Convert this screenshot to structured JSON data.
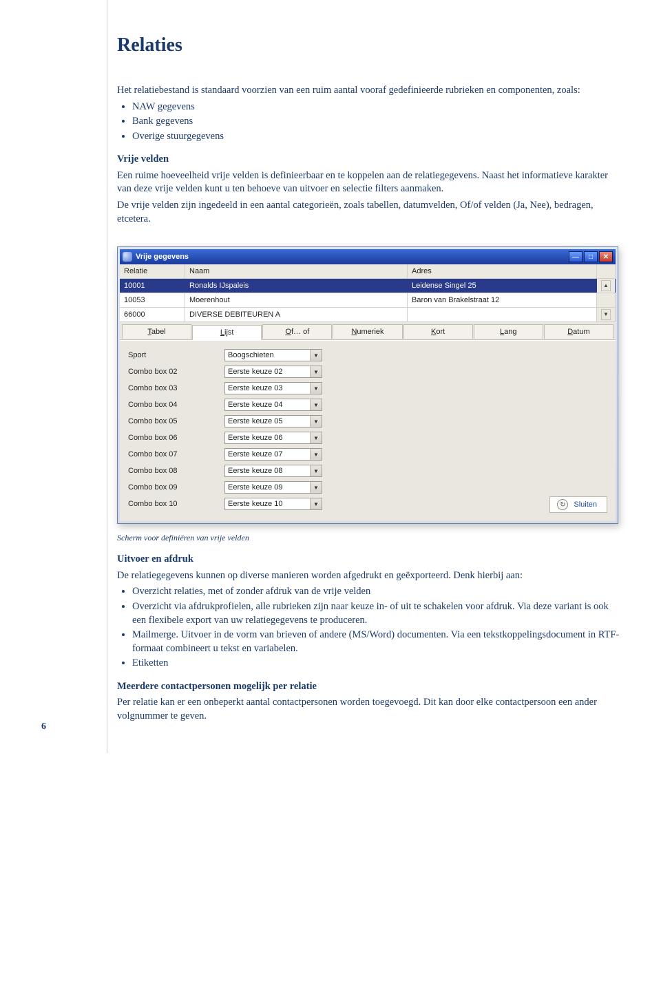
{
  "heading": "Relaties",
  "intro_p1": "Het relatiebestand is standaard voorzien van een ruim aantal vooraf gedefinieerde rubrieken en componenten, zoals:",
  "intro_bullets": [
    "NAW gegevens",
    "Bank gegevens",
    "Overige stuurgegevens"
  ],
  "vrije_head": "Vrije velden",
  "vrije_p1": "Een ruime hoeveelheid vrije velden is definieerbaar en te koppelen aan de relatiegegevens. Naast het informatieve karakter van deze vrije velden kunt u ten behoeve van uitvoer en selectie filters aanmaken.",
  "vrije_p2": "De vrije velden zijn ingedeeld in een aantal categorieën, zoals tabellen, datumvelden, Of/of velden (Ja, Nee), bedragen, etcetera.",
  "window": {
    "title": "Vrije gegevens",
    "headers": {
      "relatie": "Relatie",
      "naam": "Naam",
      "adres": "Adres"
    },
    "rows": [
      {
        "relatie": "10001",
        "naam": "Ronalds IJspaleis",
        "adres": "Leidense Singel 25",
        "selected": true
      },
      {
        "relatie": "10053",
        "naam": "Moerenhout",
        "adres": "Baron van Brakelstraat 12",
        "selected": false
      },
      {
        "relatie": "66000",
        "naam": "DIVERSE DEBITEUREN A",
        "adres": "",
        "selected": false
      }
    ],
    "tabs": [
      {
        "pre": "",
        "u": "T",
        "post": "abel"
      },
      {
        "pre": "",
        "u": "L",
        "post": "ijst",
        "active": true
      },
      {
        "pre": "",
        "u": "O",
        "post": "f… of"
      },
      {
        "pre": "",
        "u": "N",
        "post": "umeriek"
      },
      {
        "pre": "",
        "u": "K",
        "post": "ort"
      },
      {
        "pre": "",
        "u": "L",
        "post": "ang"
      },
      {
        "pre": "",
        "u": "D",
        "post": "atum"
      }
    ],
    "fields": [
      {
        "label": "Sport",
        "value": "Boogschieten"
      },
      {
        "label": "Combo box 02",
        "value": "Eerste keuze 02"
      },
      {
        "label": "Combo box 03",
        "value": "Eerste keuze 03"
      },
      {
        "label": "Combo box 04",
        "value": "Eerste keuze 04"
      },
      {
        "label": "Combo box 05",
        "value": "Eerste keuze 05"
      },
      {
        "label": "Combo box 06",
        "value": "Eerste keuze 06"
      },
      {
        "label": "Combo box 07",
        "value": "Eerste keuze 07"
      },
      {
        "label": "Combo box 08",
        "value": "Eerste keuze 08"
      },
      {
        "label": "Combo box 09",
        "value": "Eerste keuze 09"
      },
      {
        "label": "Combo box 10",
        "value": "Eerste keuze 10"
      }
    ],
    "close_label": "Sluiten"
  },
  "caption": "Scherm voor definiëren van vrije velden",
  "uitvoer_head": "Uitvoer en afdruk",
  "uitvoer_p": "De relatiegegevens kunnen op diverse manieren worden afgedrukt en geëxporteerd. Denk hierbij aan:",
  "uitvoer_bullets": [
    "Overzicht relaties, met of zonder afdruk van de vrije velden",
    "Overzicht via afdrukprofielen, alle rubrieken zijn naar keuze in- of uit te schakelen voor afdruk. Via deze variant is ook een flexibele export van uw relatiegegevens te produceren.",
    "Mailmerge. Uitvoer in de vorm van brieven of andere (MS/Word) documenten. Via een tekstkoppelingsdocument in RTF-formaat combineert u tekst en variabelen.",
    "Etiketten"
  ],
  "meerdere_head": "Meerdere contactpersonen mogelijk per relatie",
  "meerdere_p": "Per relatie kan er een onbeperkt aantal contactpersonen worden toegevoegd. Dit kan door elke contactpersoon een ander volgnummer te geven.",
  "page_number": "6"
}
